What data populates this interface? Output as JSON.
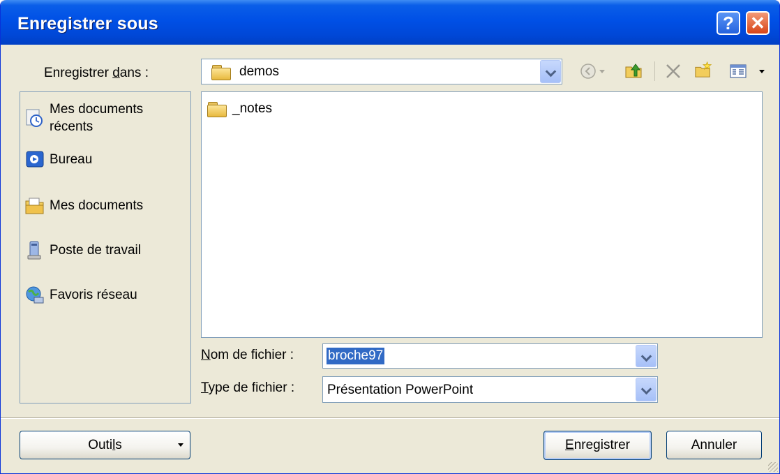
{
  "window": {
    "title": "Enregistrer sous",
    "help_label": "?",
    "close_label": "✕"
  },
  "save_in": {
    "label_pre": "Enregistrer ",
    "label_accel": "d",
    "label_post": "ans :",
    "value": "demos"
  },
  "toolbar": {
    "icons": [
      "back-icon",
      "up-folder-icon",
      "delete-icon",
      "new-folder-icon",
      "views-icon"
    ]
  },
  "places": [
    {
      "name": "recent",
      "label": "Mes documents\nrécents",
      "icon": "recent-documents-icon"
    },
    {
      "name": "desktop",
      "label": "Bureau",
      "icon": "desktop-icon"
    },
    {
      "name": "my-documents",
      "label": "Mes documents",
      "icon": "my-documents-icon"
    },
    {
      "name": "my-computer",
      "label": "Poste de travail",
      "icon": "my-computer-icon"
    },
    {
      "name": "network",
      "label": "Favoris réseau",
      "icon": "network-places-icon"
    }
  ],
  "files": [
    {
      "name": "_notes",
      "icon": "folder-icon"
    }
  ],
  "filename": {
    "label_accel": "N",
    "label_post": "om de fichier :",
    "value": "broche97"
  },
  "filetype": {
    "label_accel": "T",
    "label_post": "ype de fichier :",
    "value": "Présentation PowerPoint"
  },
  "buttons": {
    "tools_pre": "Outi",
    "tools_accel": "l",
    "tools_post": "s",
    "save_accel": "E",
    "save_post": "nregistrer",
    "cancel": "Annuler"
  },
  "colors": {
    "titlebar": "#0050e6",
    "dialog_bg": "#ece9d8",
    "selection": "#316ac5"
  }
}
